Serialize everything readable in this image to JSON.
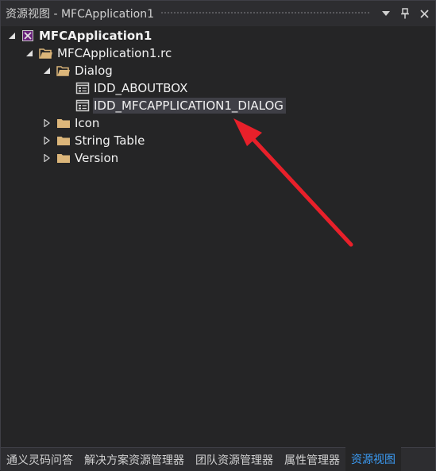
{
  "window": {
    "title": "资源视图 - MFCApplication1"
  },
  "tree": {
    "root": {
      "label": "MFCApplication1",
      "icon": "project-icon",
      "expanded": true
    },
    "rc_file": {
      "label": "MFCApplication1.rc",
      "icon": "folder-open-icon",
      "expanded": true
    },
    "dialog_folder": {
      "label": "Dialog",
      "icon": "folder-open-icon",
      "expanded": true
    },
    "dialog_items": [
      {
        "label": "IDD_ABOUTBOX",
        "icon": "dialog-resource-icon",
        "selected": false
      },
      {
        "label": "IDD_MFCAPPLICATION1_DIALOG",
        "icon": "dialog-resource-icon",
        "selected": true
      }
    ],
    "collapsed_folders": [
      {
        "label": "Icon",
        "icon": "folder-icon"
      },
      {
        "label": "String Table",
        "icon": "folder-icon"
      },
      {
        "label": "Version",
        "icon": "folder-icon"
      }
    ]
  },
  "tabs": [
    {
      "label": "通义灵码问答",
      "active": false
    },
    {
      "label": "解决方案资源管理器",
      "active": false
    },
    {
      "label": "团队资源管理器",
      "active": false
    },
    {
      "label": "属性管理器",
      "active": false
    },
    {
      "label": "资源视图",
      "active": true
    }
  ],
  "colors": {
    "background": "#252526",
    "titlebar": "#2d2d30",
    "selection": "#3f3f46",
    "folder": "#dcb67a",
    "active_tab_text": "#3b9cf5",
    "annotation_arrow": "#e8202a"
  }
}
